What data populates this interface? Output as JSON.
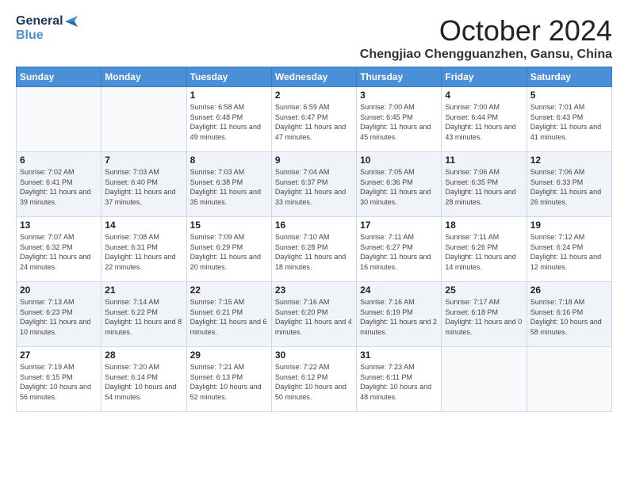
{
  "header": {
    "logo_line1": "General",
    "logo_line2": "Blue",
    "month": "October 2024",
    "location": "Chengjiao Chengguanzhen, Gansu, China"
  },
  "weekdays": [
    "Sunday",
    "Monday",
    "Tuesday",
    "Wednesday",
    "Thursday",
    "Friday",
    "Saturday"
  ],
  "weeks": [
    [
      {
        "day": "",
        "info": ""
      },
      {
        "day": "",
        "info": ""
      },
      {
        "day": "1",
        "info": "Sunrise: 6:58 AM\nSunset: 6:48 PM\nDaylight: 11 hours and 49 minutes."
      },
      {
        "day": "2",
        "info": "Sunrise: 6:59 AM\nSunset: 6:47 PM\nDaylight: 11 hours and 47 minutes."
      },
      {
        "day": "3",
        "info": "Sunrise: 7:00 AM\nSunset: 6:45 PM\nDaylight: 11 hours and 45 minutes."
      },
      {
        "day": "4",
        "info": "Sunrise: 7:00 AM\nSunset: 6:44 PM\nDaylight: 11 hours and 43 minutes."
      },
      {
        "day": "5",
        "info": "Sunrise: 7:01 AM\nSunset: 6:43 PM\nDaylight: 11 hours and 41 minutes."
      }
    ],
    [
      {
        "day": "6",
        "info": "Sunrise: 7:02 AM\nSunset: 6:41 PM\nDaylight: 11 hours and 39 minutes."
      },
      {
        "day": "7",
        "info": "Sunrise: 7:03 AM\nSunset: 6:40 PM\nDaylight: 11 hours and 37 minutes."
      },
      {
        "day": "8",
        "info": "Sunrise: 7:03 AM\nSunset: 6:38 PM\nDaylight: 11 hours and 35 minutes."
      },
      {
        "day": "9",
        "info": "Sunrise: 7:04 AM\nSunset: 6:37 PM\nDaylight: 11 hours and 33 minutes."
      },
      {
        "day": "10",
        "info": "Sunrise: 7:05 AM\nSunset: 6:36 PM\nDaylight: 11 hours and 30 minutes."
      },
      {
        "day": "11",
        "info": "Sunrise: 7:06 AM\nSunset: 6:35 PM\nDaylight: 11 hours and 28 minutes."
      },
      {
        "day": "12",
        "info": "Sunrise: 7:06 AM\nSunset: 6:33 PM\nDaylight: 11 hours and 26 minutes."
      }
    ],
    [
      {
        "day": "13",
        "info": "Sunrise: 7:07 AM\nSunset: 6:32 PM\nDaylight: 11 hours and 24 minutes."
      },
      {
        "day": "14",
        "info": "Sunrise: 7:08 AM\nSunset: 6:31 PM\nDaylight: 11 hours and 22 minutes."
      },
      {
        "day": "15",
        "info": "Sunrise: 7:09 AM\nSunset: 6:29 PM\nDaylight: 11 hours and 20 minutes."
      },
      {
        "day": "16",
        "info": "Sunrise: 7:10 AM\nSunset: 6:28 PM\nDaylight: 11 hours and 18 minutes."
      },
      {
        "day": "17",
        "info": "Sunrise: 7:11 AM\nSunset: 6:27 PM\nDaylight: 11 hours and 16 minutes."
      },
      {
        "day": "18",
        "info": "Sunrise: 7:11 AM\nSunset: 6:26 PM\nDaylight: 11 hours and 14 minutes."
      },
      {
        "day": "19",
        "info": "Sunrise: 7:12 AM\nSunset: 6:24 PM\nDaylight: 11 hours and 12 minutes."
      }
    ],
    [
      {
        "day": "20",
        "info": "Sunrise: 7:13 AM\nSunset: 6:23 PM\nDaylight: 11 hours and 10 minutes."
      },
      {
        "day": "21",
        "info": "Sunrise: 7:14 AM\nSunset: 6:22 PM\nDaylight: 11 hours and 8 minutes."
      },
      {
        "day": "22",
        "info": "Sunrise: 7:15 AM\nSunset: 6:21 PM\nDaylight: 11 hours and 6 minutes."
      },
      {
        "day": "23",
        "info": "Sunrise: 7:16 AM\nSunset: 6:20 PM\nDaylight: 11 hours and 4 minutes."
      },
      {
        "day": "24",
        "info": "Sunrise: 7:16 AM\nSunset: 6:19 PM\nDaylight: 11 hours and 2 minutes."
      },
      {
        "day": "25",
        "info": "Sunrise: 7:17 AM\nSunset: 6:18 PM\nDaylight: 11 hours and 0 minutes."
      },
      {
        "day": "26",
        "info": "Sunrise: 7:18 AM\nSunset: 6:16 PM\nDaylight: 10 hours and 58 minutes."
      }
    ],
    [
      {
        "day": "27",
        "info": "Sunrise: 7:19 AM\nSunset: 6:15 PM\nDaylight: 10 hours and 56 minutes."
      },
      {
        "day": "28",
        "info": "Sunrise: 7:20 AM\nSunset: 6:14 PM\nDaylight: 10 hours and 54 minutes."
      },
      {
        "day": "29",
        "info": "Sunrise: 7:21 AM\nSunset: 6:13 PM\nDaylight: 10 hours and 52 minutes."
      },
      {
        "day": "30",
        "info": "Sunrise: 7:22 AM\nSunset: 6:12 PM\nDaylight: 10 hours and 50 minutes."
      },
      {
        "day": "31",
        "info": "Sunrise: 7:23 AM\nSunset: 6:11 PM\nDaylight: 10 hours and 48 minutes."
      },
      {
        "day": "",
        "info": ""
      },
      {
        "day": "",
        "info": ""
      }
    ]
  ]
}
